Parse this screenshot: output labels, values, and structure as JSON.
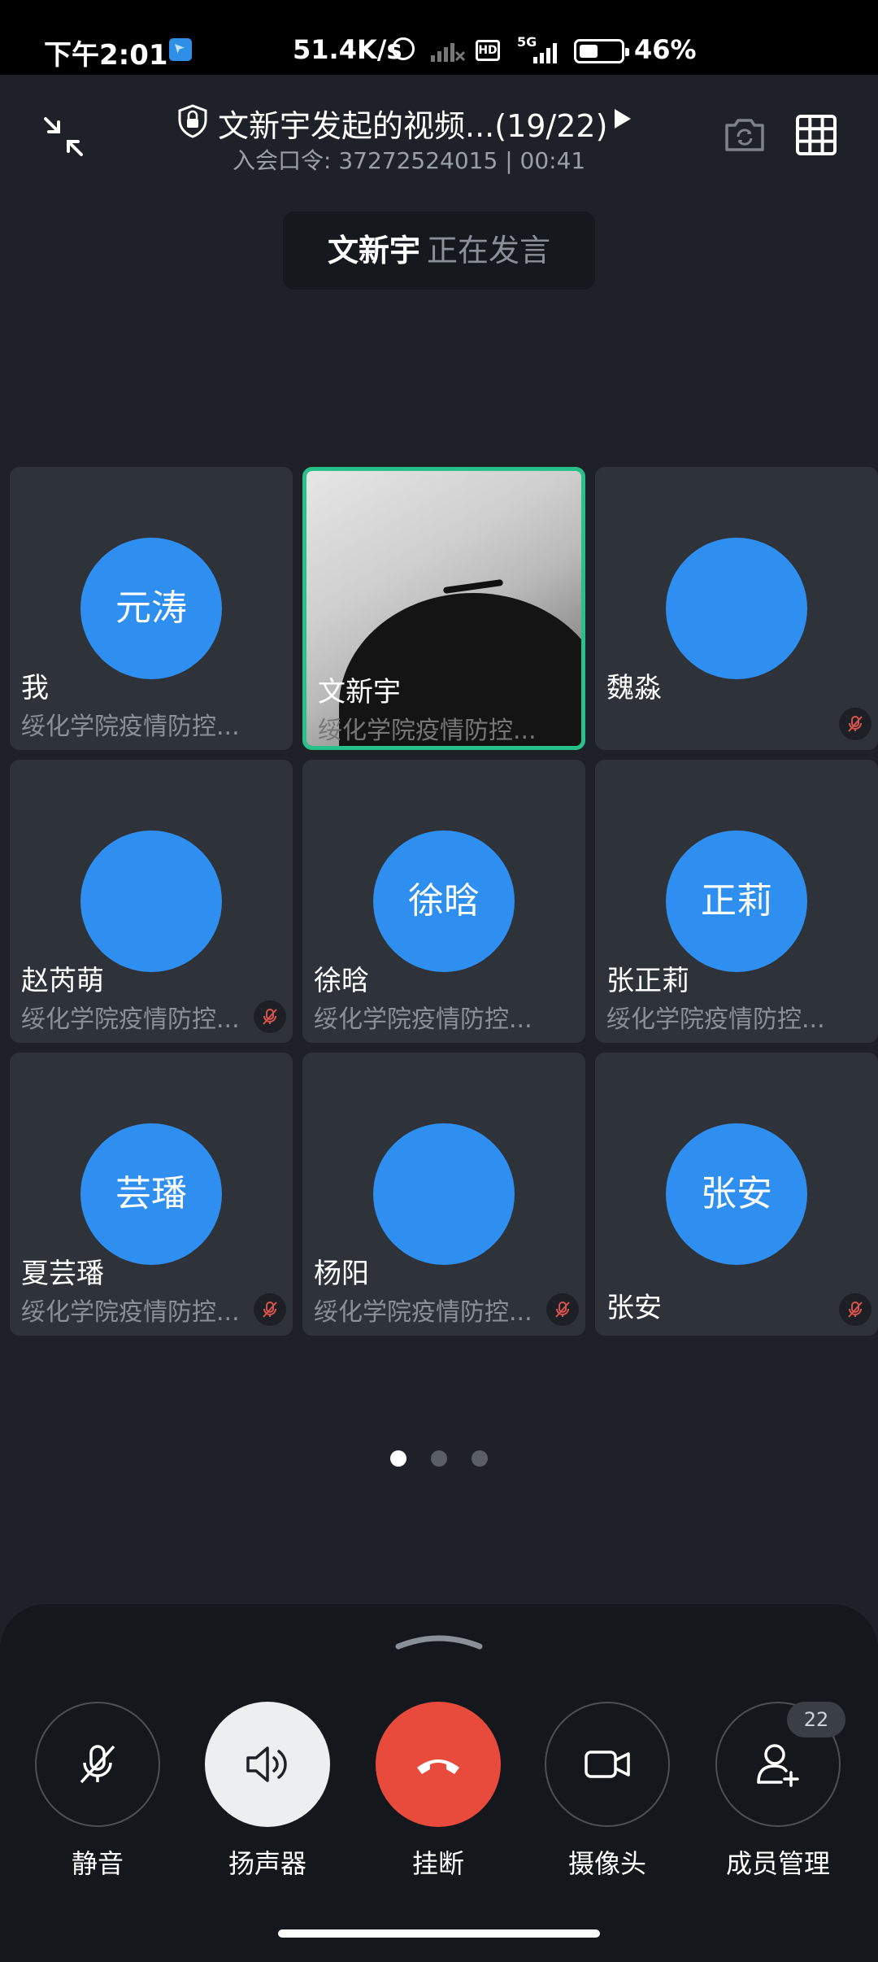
{
  "status_bar": {
    "time": "下午2:01",
    "net_speed": "51.4K/s",
    "network": "5G",
    "battery": "46%",
    "icons": [
      "app-notification-icon",
      "alarm-icon",
      "no-signal-icon",
      "hd-icon",
      "5g-signal-icon",
      "battery-icon"
    ]
  },
  "header": {
    "title": "文新宇发起的视频...(19/22)",
    "subtitle": "入会口令: 37272524015 | 00:41",
    "icons": [
      "collapse-icon",
      "lock-shield-icon",
      "play-icon",
      "switch-camera-icon",
      "grid-view-icon"
    ]
  },
  "speaking": {
    "name": "文新宇",
    "status": "正在发言"
  },
  "participants": [
    {
      "name": "我",
      "avatar_text": "元涛",
      "org": "绥化学院疫情防控...",
      "muted": false,
      "type": "text"
    },
    {
      "name": "文新宇",
      "avatar_text": "",
      "org": "绥化学院疫情防控...",
      "muted": false,
      "type": "video",
      "active": true
    },
    {
      "name": "魏淼",
      "avatar_text": "",
      "org": "",
      "muted": true,
      "type": "photo"
    },
    {
      "name": "赵芮萌",
      "avatar_text": "",
      "org": "绥化学院疫情防控...",
      "muted": true,
      "type": "photo"
    },
    {
      "name": "徐晗",
      "avatar_text": "徐晗",
      "org": "绥化学院疫情防控...",
      "muted": false,
      "type": "text"
    },
    {
      "name": "张正莉",
      "avatar_text": "正莉",
      "org": "绥化学院疫情防控...",
      "muted": false,
      "type": "text"
    },
    {
      "name": "夏芸璠",
      "avatar_text": "芸璠",
      "org": "绥化学院疫情防控...",
      "muted": true,
      "type": "text"
    },
    {
      "name": "杨阳",
      "avatar_text": "",
      "org": "绥化学院疫情防控...",
      "muted": true,
      "type": "photo"
    },
    {
      "name": "张安",
      "avatar_text": "张安",
      "org": "",
      "muted": true,
      "type": "text"
    }
  ],
  "pager": {
    "current": 1,
    "total": 3
  },
  "controls": [
    {
      "label": "静音",
      "icon": "mic-off-icon"
    },
    {
      "label": "扬声器",
      "icon": "speaker-icon"
    },
    {
      "label": "挂断",
      "icon": "hangup-icon"
    },
    {
      "label": "摄像头",
      "icon": "camera-icon"
    },
    {
      "label": "成员管理",
      "icon": "add-member-icon"
    }
  ],
  "member_count": "22",
  "colors": {
    "accent_blue": "#2e8ff0",
    "active_border": "#27c28a",
    "hangup_red": "#e84a3b",
    "background": "#1e2228"
  }
}
